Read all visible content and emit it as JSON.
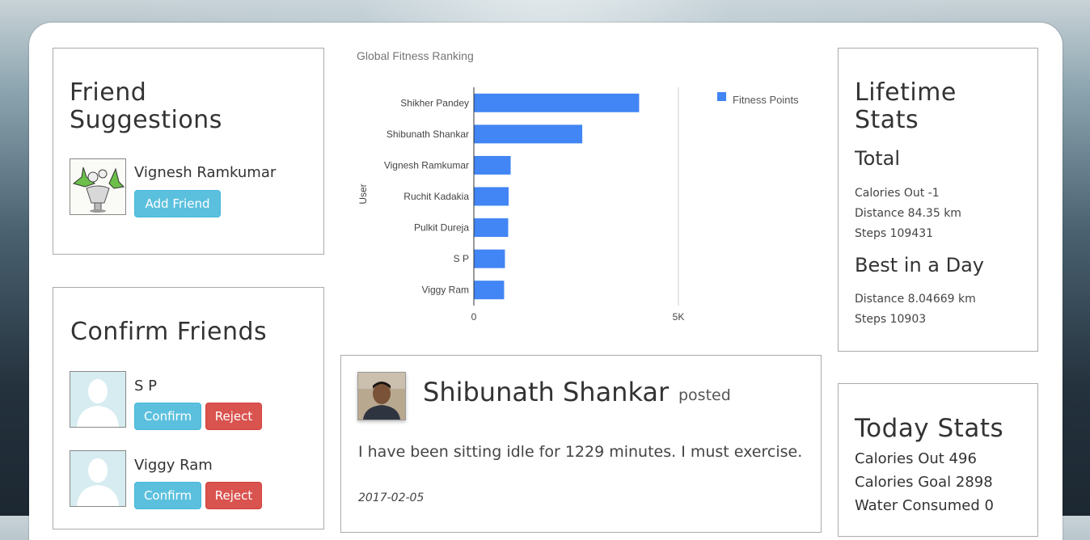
{
  "friend_suggestions": {
    "title": "Friend Suggestions",
    "people": [
      {
        "name": "Vignesh Ramkumar",
        "action_label": "Add Friend"
      }
    ]
  },
  "confirm_friends": {
    "title": "Confirm Friends",
    "requests": [
      {
        "name": "S P",
        "confirm_label": "Confirm",
        "reject_label": "Reject"
      },
      {
        "name": "Viggy Ram",
        "confirm_label": "Confirm",
        "reject_label": "Reject"
      }
    ]
  },
  "chart_data": {
    "type": "bar",
    "orientation": "horizontal",
    "title": "Global Fitness Ranking",
    "ylabel": "User",
    "xlabel": "",
    "categories": [
      "Shikher Pandey",
      "Shibunath Shankar",
      "Vignesh Ramkumar",
      "Ruchit Kadakia",
      "Pulkit Dureja",
      "S P",
      "Viggy Ram"
    ],
    "series": [
      {
        "name": "Fitness Points",
        "values": [
          4040,
          2650,
          900,
          850,
          840,
          760,
          740
        ]
      }
    ],
    "x_ticks": [
      "0",
      "5K"
    ],
    "xlim": [
      0,
      5000
    ],
    "legend_position": "top-right",
    "grid": true,
    "colors": [
      "#4285f4"
    ]
  },
  "post": {
    "author": "Shibunath Shankar",
    "verb": "posted",
    "body": "I have been sitting idle for 1229 minutes. I must exercise.",
    "date": "2017-02-05"
  },
  "lifetime_stats": {
    "title": "Lifetime Stats",
    "total_heading": "Total",
    "total": {
      "calories_out": "Calories Out -1",
      "distance": "Distance 84.35 km",
      "steps": "Steps 109431"
    },
    "best_heading": "Best in a Day",
    "best": {
      "distance": "Distance 8.04669 km",
      "steps": "Steps 10903"
    }
  },
  "today_stats": {
    "title": "Today Stats",
    "calories_out": "Calories Out 496",
    "calories_goal": "Calories Goal 2898",
    "water_consumed": "Water Consumed 0"
  },
  "colors": {
    "info_button": "#5bc0de",
    "danger_button": "#d9534f",
    "bar": "#4285f4"
  }
}
